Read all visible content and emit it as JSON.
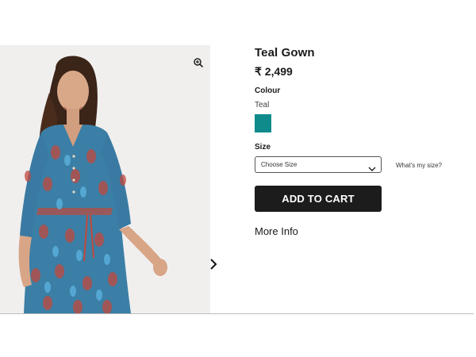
{
  "product": {
    "title": "Teal Gown",
    "price": "₹ 2,499",
    "colour_label": "Colour",
    "colour_value": "Teal",
    "swatch_color": "#108b8c",
    "size_label": "Size",
    "size_select_value": "Choose Size",
    "size_help": "What's my size?",
    "add_to_cart": "ADD TO CART",
    "more_info": "More Info"
  },
  "gallery": {
    "zoom_icon": "zoom-in-icon",
    "next_icon": "chevron-right-icon",
    "image": "model wearing blue and red printed gown"
  }
}
